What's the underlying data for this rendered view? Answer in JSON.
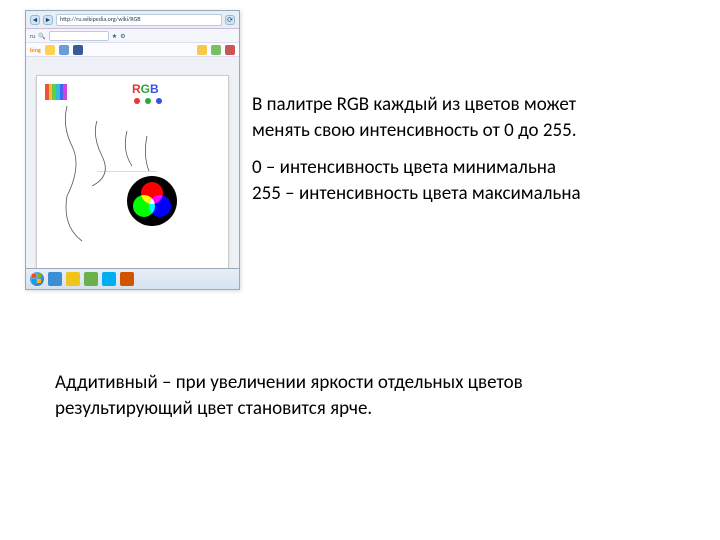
{
  "browser": {
    "url": "http://ru.wikipedia.org/wiki/RGB",
    "nav_back": "◄",
    "nav_fwd": "►",
    "ext_label": "ru",
    "search_placeholder": "",
    "bookmark_bing": "bing",
    "rgb_label": "RGB",
    "r": "R",
    "g": "G",
    "b": "B"
  },
  "text": {
    "p1": "В палитре RGB каждый из цветов может менять свою интенсивность от 0 до 255.",
    "p2a": "0 – интенсивность цвета минимальна",
    "p2b": "255 – интенсивность цвета максимальна",
    "p3": "Аддитивный – при увеличении яркости отдельных цветов результирующий цвет становится ярче."
  }
}
